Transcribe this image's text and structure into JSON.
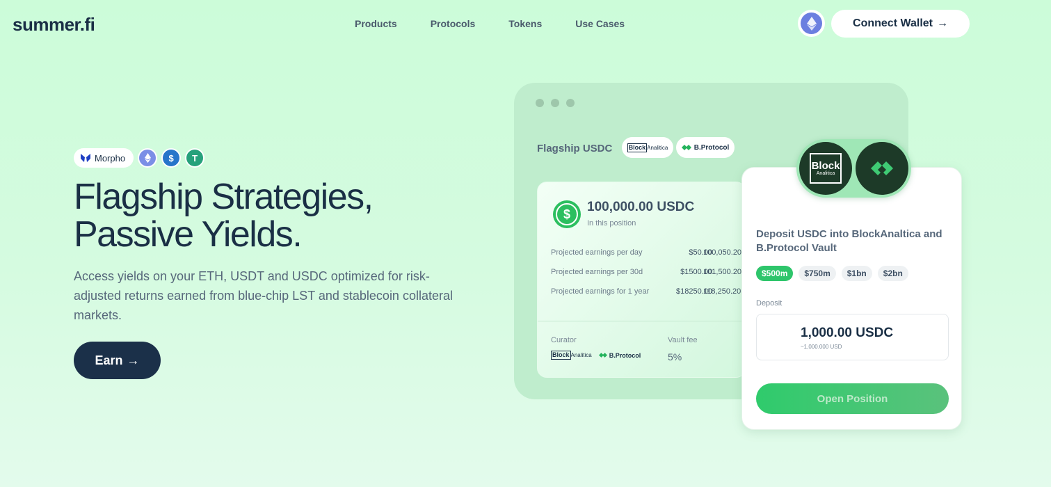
{
  "brand": {
    "logo_text": "summer.fi"
  },
  "nav": {
    "items": [
      "Products",
      "Protocols",
      "Tokens",
      "Use Cases"
    ]
  },
  "header": {
    "connect_label": "Connect Wallet",
    "network_icon": "ethereum-icon"
  },
  "hero": {
    "chips": {
      "morpho_label": "Morpho",
      "coins": [
        "ethereum-icon",
        "usdc-icon",
        "tether-icon"
      ]
    },
    "title_line1": "Flagship Strategies,",
    "title_line2": "Passive Yields.",
    "description": "Access yields on your ETH, USDT and USDC optimized for risk-adjusted returns earned from blue-chip LST and stablecoin collateral markets.",
    "cta_label": "Earn"
  },
  "vault_window": {
    "title": "Flagship USDC",
    "curator_pills": {
      "block_mark": "Block",
      "block_suffix": "Analitica",
      "bprotocol": "B.Protocol"
    },
    "position": {
      "amount": "100,000.00 USDC",
      "subtitle": "In this position",
      "rows": [
        {
          "label": "Projected earnings per day",
          "value": "$50.00",
          "total": "100,050.20"
        },
        {
          "label": "Projected earnings per 30d",
          "value": "$1500.00",
          "total": "101,500.20"
        },
        {
          "label": "Projected earnings for 1 year",
          "value": "$18250.00",
          "total": "118,250.20"
        }
      ],
      "curator_label": "Curator",
      "fee_label": "Vault fee",
      "fee_value": "5%"
    }
  },
  "deposit_card": {
    "badge_block_title": "Block",
    "badge_block_sub": "Analitica",
    "title": "Deposit USDC into BlockAnaltica and B.Protocol Vault",
    "amounts": [
      "$500m",
      "$750m",
      "$1bn",
      "$2bn"
    ],
    "active_amount": "$500m",
    "deposit_label": "Deposit",
    "deposit_value": "1,000.00 USDC",
    "deposit_sub": "~1,000.000 USD",
    "button_label": "Open Position"
  },
  "colors": {
    "accent_green": "#2ec56b",
    "navy": "#1b3049",
    "background": "#ccfcd9"
  }
}
